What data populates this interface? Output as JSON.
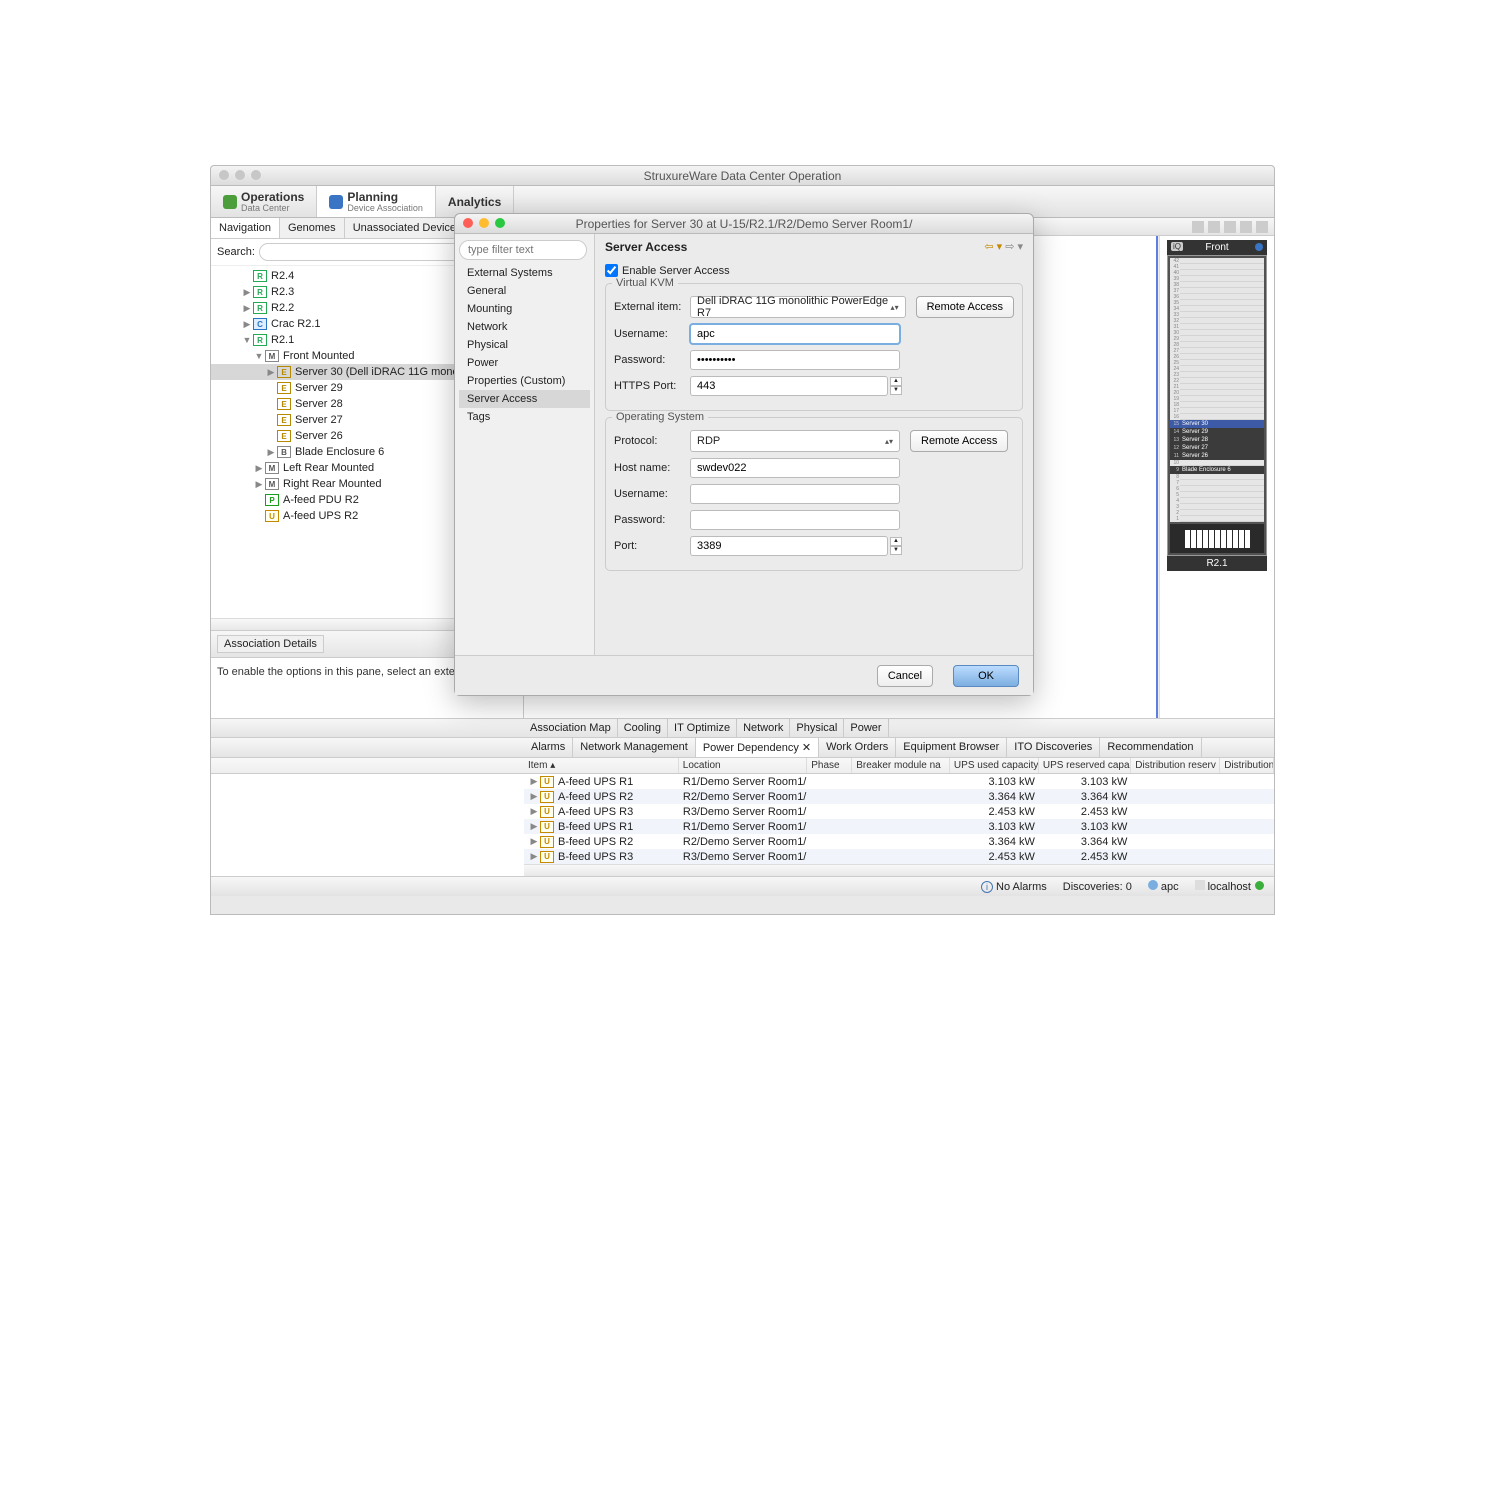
{
  "app": {
    "title": "StruxureWare Data Center Operation"
  },
  "perspectives": [
    {
      "title": "Operations",
      "sub": "Data Center"
    },
    {
      "title": "Planning",
      "sub": "Device Association"
    },
    {
      "title": "Analytics",
      "sub": ""
    }
  ],
  "nav": {
    "tabs": [
      "Navigation",
      "Genomes",
      "Unassociated Devices"
    ],
    "searchLabel": "Search:",
    "tree": [
      {
        "indent": 1,
        "twisty": "",
        "badge": "R",
        "label": "R2.4"
      },
      {
        "indent": 1,
        "twisty": "▶",
        "badge": "R",
        "label": "R2.3"
      },
      {
        "indent": 1,
        "twisty": "▶",
        "badge": "R",
        "label": "R2.2"
      },
      {
        "indent": 1,
        "twisty": "▶",
        "badge": "C",
        "label": "Crac R2.1"
      },
      {
        "indent": 1,
        "twisty": "▼",
        "badge": "R",
        "label": "R2.1"
      },
      {
        "indent": 2,
        "twisty": "▼",
        "badge": "M",
        "label": "Front Mounted"
      },
      {
        "indent": 3,
        "twisty": "▶",
        "badge": "E",
        "label": "Server 30 (Dell iDRAC 11G mono",
        "sel": true
      },
      {
        "indent": 3,
        "twisty": "",
        "badge": "E",
        "label": "Server 29"
      },
      {
        "indent": 3,
        "twisty": "",
        "badge": "E",
        "label": "Server 28"
      },
      {
        "indent": 3,
        "twisty": "",
        "badge": "E",
        "label": "Server 27"
      },
      {
        "indent": 3,
        "twisty": "",
        "badge": "E",
        "label": "Server 26"
      },
      {
        "indent": 3,
        "twisty": "▶",
        "badge": "B",
        "label": "Blade Enclosure 6"
      },
      {
        "indent": 2,
        "twisty": "▶",
        "badge": "M",
        "label": "Left Rear Mounted"
      },
      {
        "indent": 2,
        "twisty": "▶",
        "badge": "M",
        "label": "Right Rear Mounted"
      },
      {
        "indent": 2,
        "twisty": "",
        "badge": "P",
        "label": "A-feed PDU R2"
      },
      {
        "indent": 2,
        "twisty": "",
        "badge": "U",
        "label": "A-feed UPS R2"
      }
    ]
  },
  "assoc": {
    "tab": "Association Details",
    "text": "To enable the options in this pane, select an external s"
  },
  "rack": {
    "header": "Front",
    "footer": "R2.1",
    "iq": "iQ",
    "topU": 42,
    "selU": 15,
    "items": [
      {
        "u": 15,
        "label": "Server 30",
        "sel": true
      },
      {
        "u": 14,
        "label": "Server 29"
      },
      {
        "u": 13,
        "label": "Server 28"
      },
      {
        "u": 12,
        "label": "Server 27"
      },
      {
        "u": 11,
        "label": "Server 26"
      },
      {
        "u": 10,
        "label": ""
      },
      {
        "u": 9,
        "label": "Blade Enclosure 6"
      }
    ]
  },
  "bottom": {
    "tabs1": [
      "Association Map",
      "Cooling",
      "IT Optimize",
      "Network",
      "Physical",
      "Power"
    ],
    "tabs2": [
      "Alarms",
      "Network Management",
      "Power Dependency ✕",
      "Work Orders",
      "Equipment Browser",
      "ITO Discoveries",
      "Recommendation"
    ],
    "active2": 2,
    "cols": [
      "Item",
      "Location",
      "Phase",
      "Breaker module na",
      "UPS used capacity",
      "UPS reserved capa",
      "Distribution reserv",
      "Distribution"
    ],
    "rows": [
      {
        "badge": "U",
        "item": "A-feed UPS R1",
        "loc": "R1/Demo Server Room1/",
        "cap": "3.103 kW",
        "res": "3.103 kW"
      },
      {
        "badge": "U",
        "item": "A-feed UPS R2",
        "loc": "R2/Demo Server Room1/",
        "cap": "3.364 kW",
        "res": "3.364 kW"
      },
      {
        "badge": "U",
        "item": "A-feed UPS R3",
        "loc": "R3/Demo Server Room1/",
        "cap": "2.453 kW",
        "res": "2.453 kW"
      },
      {
        "badge": "U",
        "item": "B-feed UPS R1",
        "loc": "R1/Demo Server Room1/",
        "cap": "3.103 kW",
        "res": "3.103 kW"
      },
      {
        "badge": "U",
        "item": "B-feed UPS R2",
        "loc": "R2/Demo Server Room1/",
        "cap": "3.364 kW",
        "res": "3.364 kW"
      },
      {
        "badge": "U",
        "item": "B-feed UPS R3",
        "loc": "R3/Demo Server Room1/",
        "cap": "2.453 kW",
        "res": "2.453 kW"
      }
    ]
  },
  "status": {
    "alarms": "No Alarms",
    "discoveries": "Discoveries: 0",
    "user": "apc",
    "host": "localhost"
  },
  "dialog": {
    "title": "Properties for Server 30 at U-15/R2.1/R2/Demo Server Room1/",
    "filter": "type filter text",
    "categories": [
      "External Systems",
      "General",
      "Mounting",
      "Network",
      "Physical",
      "Power",
      "Properties (Custom)",
      "Server Access",
      "Tags"
    ],
    "selectedCat": "Server Access",
    "section": "Server Access",
    "enable": "Enable Server Access",
    "kvm": {
      "legend": "Virtual KVM",
      "labels": {
        "ext": "External item:",
        "user": "Username:",
        "pass": "Password:",
        "port": "HTTPS Port:"
      },
      "ext": "Dell iDRAC 11G monolithic PowerEdge R7",
      "user": "apc",
      "pass": "••••••••••",
      "port": "443",
      "btn": "Remote Access"
    },
    "os": {
      "legend": "Operating System",
      "labels": {
        "proto": "Protocol:",
        "host": "Host name:",
        "user": "Username:",
        "pass": "Password:",
        "port": "Port:"
      },
      "proto": "RDP",
      "host": "swdev022",
      "user": "",
      "pass": "",
      "port": "3389",
      "btn": "Remote Access"
    },
    "cancel": "Cancel",
    "ok": "OK"
  }
}
